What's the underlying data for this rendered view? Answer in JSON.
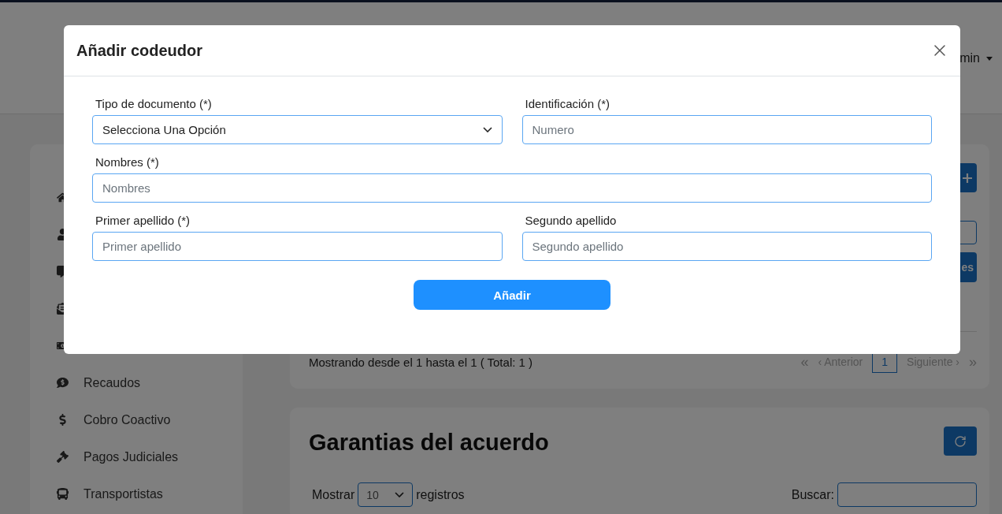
{
  "header": {
    "user_menu": "min"
  },
  "sidebar": {
    "items": [
      {
        "kind": "home"
      },
      {
        "kind": "user"
      },
      {
        "kind": "chat"
      },
      {
        "kind": "envelope"
      },
      {
        "kind": "bill"
      },
      {
        "kind": "chat-dollar",
        "label": "Recaudos"
      },
      {
        "kind": "dollar",
        "label": "Cobro Coactivo"
      },
      {
        "kind": "gavel",
        "label": "Pagos Judiciales"
      },
      {
        "kind": "bus",
        "label": "Transportistas"
      }
    ]
  },
  "card_1": {
    "side_button": "es",
    "pagination_info": "Mostrando desde el 1 hasta el 1 ( Total: 1 )",
    "pagination": [
      {
        "label": "«",
        "kind": "arrow",
        "selected": false
      },
      {
        "label": "‹ Anterior",
        "kind": "text",
        "selected": false
      },
      {
        "label": "1",
        "kind": "page",
        "selected": true
      },
      {
        "label": "Siguiente ›",
        "kind": "text",
        "selected": false
      },
      {
        "label": "»",
        "kind": "arrow",
        "selected": false
      }
    ]
  },
  "card_2": {
    "title": "Garantias del acuerdo",
    "show_label": "Mostrar",
    "page_size": "10",
    "records_label": "registros",
    "search_label": "Buscar:"
  },
  "modal": {
    "title": "Añadir codeudor",
    "rows": [
      [
        {
          "label": "Tipo de documento (*)",
          "kind": "select",
          "value": "Selecciona Una Opción"
        },
        {
          "label": "Identificación (*)",
          "kind": "input",
          "placeholder": "Numero"
        }
      ],
      [
        {
          "label": "Nombres (*)",
          "kind": "input",
          "placeholder": "Nombres"
        }
      ],
      [
        {
          "label": "Primer apellido (*)",
          "kind": "input",
          "placeholder": "Primer apellido"
        },
        {
          "label": "Segundo apellido",
          "kind": "input",
          "placeholder": "Segundo apellido"
        }
      ]
    ],
    "submit": "Añadir"
  }
}
